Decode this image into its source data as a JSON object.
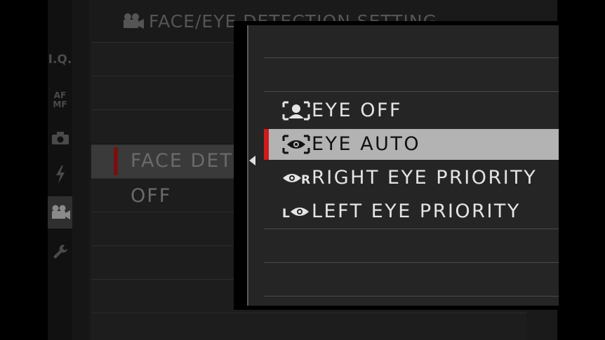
{
  "title": "FACE/EYE DETECTION SETTING",
  "sidebar": {
    "tabs": [
      {
        "label": "I.Q.",
        "icon": ""
      },
      {
        "label": "AF MF",
        "icon": ""
      },
      {
        "label": "",
        "icon": "camera-icon"
      },
      {
        "label": "",
        "icon": "flash-icon"
      },
      {
        "label": "",
        "icon": "movie-camera-icon",
        "active": true
      },
      {
        "label": "",
        "icon": "wrench-icon"
      }
    ]
  },
  "background_menu": {
    "selected_item": "FACE DET",
    "value": "OFF"
  },
  "popup": {
    "options": [
      {
        "label": "EYE OFF",
        "icon": "eye-off-icon",
        "selected": false
      },
      {
        "label": "EYE AUTO",
        "icon": "eye-auto-icon",
        "selected": true
      },
      {
        "label": "RIGHT EYE PRIORITY",
        "icon": "right-eye-icon",
        "selected": false
      },
      {
        "label": "LEFT EYE PRIORITY",
        "icon": "left-eye-icon",
        "selected": false
      }
    ]
  },
  "colors": {
    "accent_red": "#d11a1a",
    "selected_bg": "#b3b3b3",
    "text": "#e4e4e4"
  }
}
